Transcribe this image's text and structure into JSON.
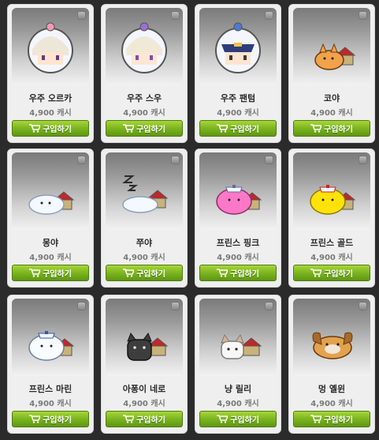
{
  "items": [
    {
      "name": "우주 오르카",
      "price": "4,900 캐시",
      "buy": "구입하기",
      "icon": "space-helmet-pet-icon"
    },
    {
      "name": "우주 스우",
      "price": "4,900 캐시",
      "buy": "구입하기",
      "icon": "space-helmet-pet-icon"
    },
    {
      "name": "우주 팬텀",
      "price": "4,900 캐시",
      "buy": "구입하기",
      "icon": "space-helmet-pet-icon"
    },
    {
      "name": "코야",
      "price": "4,900 캐시",
      "buy": "구입하기",
      "icon": "orange-pet-icon"
    },
    {
      "name": "몽야",
      "price": "4,900 캐시",
      "buy": "구입하기",
      "icon": "white-seal-pet-icon"
    },
    {
      "name": "쭈야",
      "price": "4,900 캐시",
      "buy": "구입하기",
      "icon": "sleeping-seal-pet-icon"
    },
    {
      "name": "프린스 핑크",
      "price": "4,900 캐시",
      "buy": "구입하기",
      "icon": "pink-seal-pet-icon"
    },
    {
      "name": "프린스 골드",
      "price": "4,900 캐시",
      "buy": "구입하기",
      "icon": "gold-seal-pet-icon"
    },
    {
      "name": "프린스 마린",
      "price": "4,900 캐시",
      "buy": "구입하기",
      "icon": "marine-seal-pet-icon"
    },
    {
      "name": "아퐁이 네로",
      "price": "4,900 캐시",
      "buy": "구입하기",
      "icon": "black-cat-pet-icon"
    },
    {
      "name": "냥 릴리",
      "price": "4,900 캐시",
      "buy": "구입하기",
      "icon": "white-cat-pet-icon"
    },
    {
      "name": "멍 옐윈",
      "price": "4,900 캐시",
      "buy": "구입하기",
      "icon": "dog-pet-icon"
    }
  ],
  "colors": {
    "buy_button": "#7bb51f",
    "card": "#efefef",
    "background": "#2b2b2b"
  }
}
